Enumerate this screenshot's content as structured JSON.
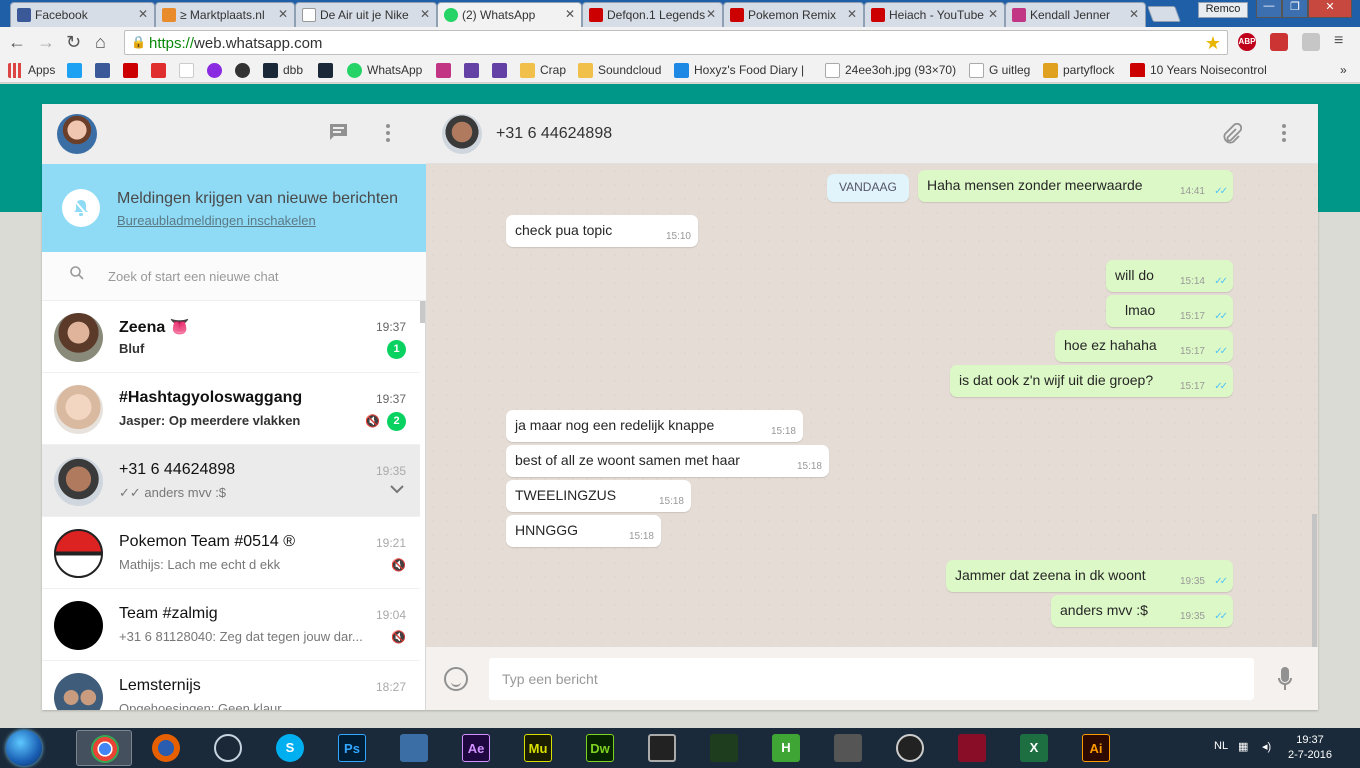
{
  "browser": {
    "tabs": [
      {
        "label": "Facebook",
        "fav_color": "#3b5998"
      },
      {
        "label": "≥ Marktplaats.nl",
        "fav_color": "#e98b2b"
      },
      {
        "label": "De Air uit je Nike",
        "fav_color": "#ffffff"
      },
      {
        "label": "(2) WhatsApp",
        "fav_color": "#25d366"
      },
      {
        "label": "Defqon.1 Legends",
        "fav_color": "#cc0000"
      },
      {
        "label": "Pokemon Remix",
        "fav_color": "#cc0000"
      },
      {
        "label": "Heiach - YouTube",
        "fav_color": "#cc0000"
      },
      {
        "label": "Kendall Jenner",
        "fav_color": "#c13584"
      }
    ],
    "profile_name": "Remco",
    "url_scheme": "https://",
    "url_host": "web.whatsapp.com",
    "extensions": [
      "ABP"
    ],
    "bookmarks": [
      {
        "label": "Apps"
      },
      {
        "label": "dbb"
      },
      {
        "label": "WhatsApp"
      },
      {
        "label": "Crap"
      },
      {
        "label": "Soundcloud"
      },
      {
        "label": "Hoxyz's Food Diary |"
      },
      {
        "label": "24ee3oh.jpg (93×70)"
      },
      {
        "label": "G uitleg"
      },
      {
        "label": "partyflock"
      },
      {
        "label": "10 Years Noisecontrol"
      }
    ],
    "overflow_label": "»"
  },
  "notification": {
    "title": "Meldingen krijgen van nieuwe berichten",
    "link": "Bureaubladmeldingen inschakelen"
  },
  "search": {
    "placeholder": "Zoek of start een nieuwe chat"
  },
  "chats": [
    {
      "name": "Zeena 👅",
      "time": "19:37",
      "preview": "Bluf",
      "unread": "1",
      "muted": false,
      "bold": true
    },
    {
      "name": "#Hashtagyoloswaggang",
      "time": "19:37",
      "preview": "Jasper: Op meerdere vlakken",
      "unread": "2",
      "muted": true,
      "bold": true
    },
    {
      "name": "+31 6 44624898",
      "time": "19:35",
      "preview": "✓✓ anders mvv :$",
      "unread": "",
      "muted": false,
      "bold": false,
      "selected": true
    },
    {
      "name": "Pokemon Team #0514 ®",
      "time": "19:21",
      "preview": "Mathijs: Lach me echt d ekk",
      "unread": "",
      "muted": true,
      "bold": false
    },
    {
      "name": "Team #zalmig",
      "time": "19:04",
      "preview": "+31 6 81128040: Zeg dat tegen jouw dar...",
      "unread": "",
      "muted": true,
      "bold": false
    },
    {
      "name": "Lemsternijs",
      "time": "18:27",
      "preview": "Opgehoesingen: Geen klaur",
      "unread": "",
      "muted": false,
      "bold": false
    }
  ],
  "conversation": {
    "contact": "+31 6 44624898",
    "date_label": "VANDAAG",
    "messages": [
      {
        "dir": "out",
        "text": "Haha mensen zonder meerwaarde",
        "time": "14:41"
      },
      {
        "dir": "in",
        "text": "check pua topic",
        "time": "15:10"
      },
      {
        "dir": "out",
        "text": "will do",
        "time": "15:14"
      },
      {
        "dir": "out",
        "text": "lmao",
        "time": "15:17"
      },
      {
        "dir": "out",
        "text": "hoe ez hahaha",
        "time": "15:17"
      },
      {
        "dir": "out",
        "text": "is dat ook z'n wijf uit die groep?",
        "time": "15:17"
      },
      {
        "dir": "in",
        "text": "ja maar nog een redelijk knappe",
        "time": "15:18"
      },
      {
        "dir": "in",
        "text": "best of all ze woont samen met haar",
        "time": "15:18"
      },
      {
        "dir": "in",
        "text": "TWEELINGZUS",
        "time": "15:18"
      },
      {
        "dir": "in",
        "text": "HNNGGG",
        "time": "15:18"
      },
      {
        "dir": "out",
        "text": "Jammer dat zeena in dk woont",
        "time": "19:35"
      },
      {
        "dir": "out",
        "text": "anders mvv :$",
        "time": "19:35"
      }
    ],
    "check_mark": "✓✓"
  },
  "composer": {
    "placeholder": "Typ een bericht"
  },
  "taskbar": {
    "apps": [
      {
        "label": "",
        "color": "#ffffff"
      },
      {
        "label": "",
        "color": "#e66000"
      },
      {
        "label": "",
        "color": "#1b2838"
      },
      {
        "label": "S",
        "color": "#00aff0"
      },
      {
        "label": "Ps",
        "color": "#001e36"
      },
      {
        "label": "",
        "color": "#3a6ea5"
      },
      {
        "label": "Ae",
        "color": "#1f0740"
      },
      {
        "label": "Mu",
        "color": "#1b1d00"
      },
      {
        "label": "Dw",
        "color": "#072401"
      },
      {
        "label": "",
        "color": "#222222"
      },
      {
        "label": "",
        "color": "#1e3d1e"
      },
      {
        "label": "H",
        "color": "#3fa535"
      },
      {
        "label": "",
        "color": "#555555"
      },
      {
        "label": "",
        "color": "#222222"
      },
      {
        "label": "",
        "color": "#8a0d28"
      },
      {
        "label": "X",
        "color": "#1d6f42"
      },
      {
        "label": "Ai",
        "color": "#2d0900"
      }
    ],
    "language": "NL",
    "time": "19:37",
    "date": "2-7-2016"
  }
}
